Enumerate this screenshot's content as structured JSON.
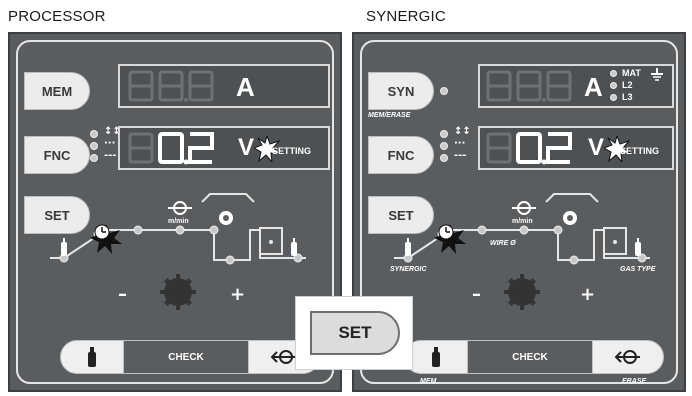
{
  "captions": {
    "left": "PROCESSOR",
    "right": "SYNERGIC"
  },
  "processor": {
    "buttons": {
      "mem": "MEM",
      "fnc": "FNC",
      "set": "SET"
    },
    "display_top": {
      "digits": "88.8",
      "unit": "A"
    },
    "display_bottom": {
      "digits_dim": "8",
      "digits_lit": "0.2",
      "unit": "V",
      "setting": "SETTING"
    },
    "speed_label": "m/min",
    "minus": "–",
    "plus": "+",
    "bottom_bar": {
      "check": "CHECK"
    }
  },
  "synergic": {
    "buttons": {
      "syn": "SYN",
      "fnc": "FNC",
      "set": "SET"
    },
    "syn_sub": "MEM/ERASE",
    "display_top": {
      "digits": "88.8",
      "unit": "A"
    },
    "leds": {
      "mat": "MAT",
      "l2": "L2",
      "l3": "L3"
    },
    "display_bottom": {
      "digits_dim": "8",
      "digits_lit": "0.2",
      "unit": "V",
      "setting": "SETTING"
    },
    "speed_label": "m/min",
    "wire_label": "WIRE Ø",
    "synergic_label": "SYNERGIC",
    "gas_type_label": "GAS TYPE",
    "minus": "–",
    "plus": "+",
    "bottom_bar": {
      "check": "CHECK",
      "mem": "MEM",
      "erase": "ERASE"
    }
  },
  "callout": {
    "label": "SET"
  },
  "icons": [
    "gas-cylinder-icon",
    "wire-feed-icon",
    "knob-icon",
    "burst-icon",
    "clock-icon"
  ],
  "colors": {
    "panel": "#5a5d60",
    "button": "#ececec",
    "display": "#4e5154",
    "led_dim": "#6f7275",
    "led_lit": "#ffffff"
  }
}
